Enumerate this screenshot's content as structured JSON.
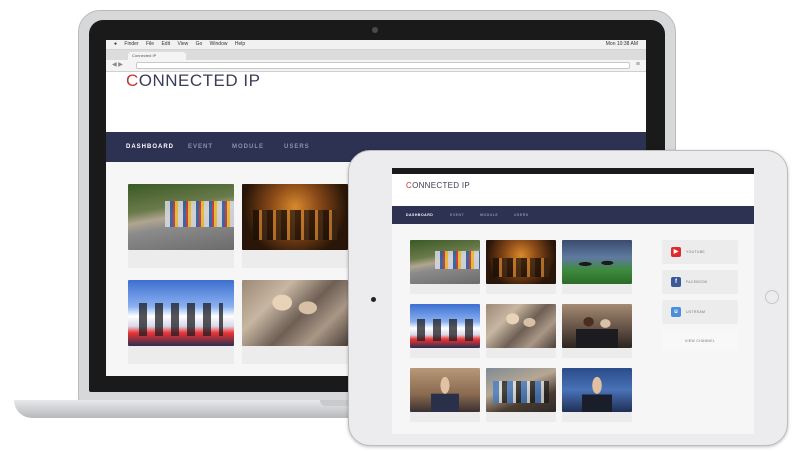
{
  "laptop": {
    "menubar": {
      "apple": "",
      "items": [
        "Finder",
        "File",
        "Edit",
        "View",
        "Go",
        "Window",
        "Help"
      ],
      "right_text": "Mon 10:38 AM"
    },
    "browser": {
      "tab_label": "Connected IP",
      "back_glyph": "◀",
      "forward_glyph": "▶",
      "menu_glyph": "≡"
    },
    "site": {
      "logo_c": "C",
      "logo_rest": "ONNECTED IP",
      "nav": [
        "DASHBOARD",
        "EVENT",
        "MODULE",
        "USERS"
      ],
      "active_nav": "DASHBOARD"
    }
  },
  "tablet": {
    "site": {
      "logo_c": "C",
      "logo_rest": "ONNECTED IP",
      "nav": [
        "DASHBOARD",
        "EVENT",
        "MODULE",
        "USERS"
      ]
    },
    "sidebar": {
      "buttons": [
        {
          "icon": "youtube-icon",
          "glyph": "▶",
          "color": "#e02a2a",
          "label": "YOUTUBE"
        },
        {
          "icon": "facebook-icon",
          "glyph": "f",
          "color": "#3b5998",
          "label": "FACEBOOK"
        },
        {
          "icon": "ustream-icon",
          "glyph": "u",
          "color": "#4a90d9",
          "label": "USTREAM"
        }
      ],
      "view_channel": "VIEW CHANNEL"
    }
  },
  "colors": {
    "nav_bg": "#2d3152",
    "logo_accent": "#c3352f",
    "logo_text": "#3b3e57"
  }
}
